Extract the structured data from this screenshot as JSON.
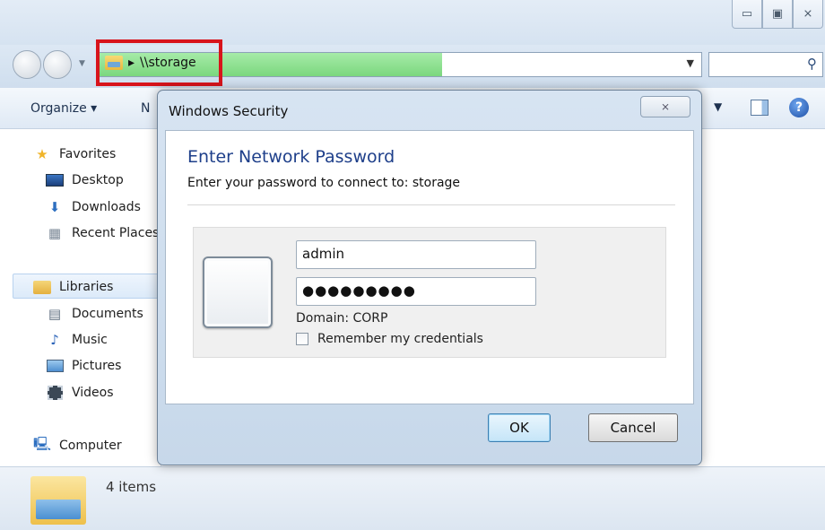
{
  "window": {
    "caption_minimize": "▭",
    "caption_maximize": "▣",
    "caption_close": "⨯"
  },
  "addressbar": {
    "path": "\\\\storage",
    "separator": "▸",
    "fill_fraction": 0.57,
    "highlight_color": "#d8141b"
  },
  "toolbar": {
    "organize": "Organize ▾",
    "new_folder_partial": "N"
  },
  "sidebar": {
    "items": [
      {
        "label": "Favorites",
        "icon": "star-icon"
      },
      {
        "label": "Desktop",
        "icon": "desktop-icon"
      },
      {
        "label": "Downloads",
        "icon": "downloads-icon"
      },
      {
        "label": "Recent Places",
        "icon": "recent-places-icon"
      },
      {
        "label": "Libraries",
        "icon": "libraries-icon"
      },
      {
        "label": "Documents",
        "icon": "documents-icon"
      },
      {
        "label": "Music",
        "icon": "music-icon"
      },
      {
        "label": "Pictures",
        "icon": "pictures-icon"
      },
      {
        "label": "Videos",
        "icon": "videos-icon"
      },
      {
        "label": "Computer",
        "icon": "computer-icon"
      }
    ]
  },
  "status": {
    "items_count": "4 items"
  },
  "dialog": {
    "title": "Windows Security",
    "close_glyph": "⨯",
    "heading": "Enter Network Password",
    "subtitle": "Enter your password to connect to: storage",
    "username_value": "admin",
    "password_value": "●●●●●●●●●",
    "domain": "Domain: CORP",
    "remember_label": "Remember my credentials",
    "remember_checked": false,
    "ok_label": "OK",
    "cancel_label": "Cancel"
  }
}
